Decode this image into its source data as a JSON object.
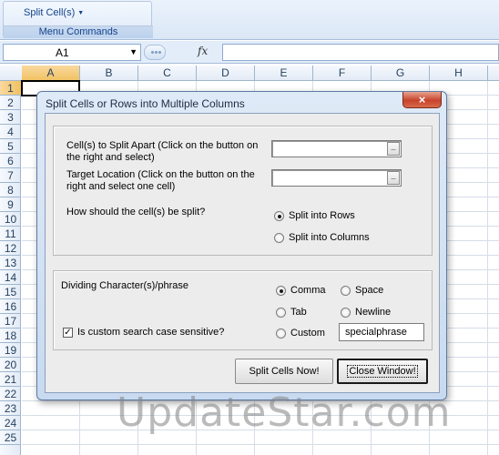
{
  "ribbon": {
    "split_menu_label": "Split Cell(s)",
    "group_label": "Menu Commands"
  },
  "formula_bar": {
    "name_box": "A1",
    "fx_label": "fx",
    "formula": ""
  },
  "grid": {
    "columns": [
      "A",
      "B",
      "C",
      "D",
      "E",
      "F",
      "G",
      "H"
    ],
    "rows": [
      "1",
      "2",
      "3",
      "4",
      "5",
      "6",
      "7",
      "8",
      "9",
      "10",
      "11",
      "12",
      "13",
      "14",
      "15",
      "16",
      "17",
      "18",
      "19",
      "20",
      "21",
      "22",
      "23",
      "24",
      "25"
    ],
    "active_column": "A",
    "active_row": "1"
  },
  "dialog": {
    "title": "Split Cells or Rows into Multiple Columns",
    "close_icon": "×",
    "split_apart_label": "Cell(s) to Split Apart (Click on the button on the right and select)",
    "split_apart_value": "",
    "target_label": "Target Location (Click on the button on the right and select one cell)",
    "target_value": "",
    "refedit_button_label": "_",
    "how_label": "How should the cell(s) be split?",
    "split_mode_options": [
      {
        "label": "Split into Rows",
        "checked": true
      },
      {
        "label": "Split into Columns",
        "checked": false
      }
    ],
    "dividing_label": "Dividing Character(s)/phrase",
    "dividers": [
      {
        "label": "Comma",
        "checked": true
      },
      {
        "label": "Space",
        "checked": false
      },
      {
        "label": "Tab",
        "checked": false
      },
      {
        "label": "Newline",
        "checked": false
      },
      {
        "label": "Custom",
        "checked": false
      }
    ],
    "custom_phrase": "specialphrase",
    "case_sensitive_label": "Is custom search case sensitive?",
    "case_sensitive_checked": true,
    "split_now_label": "Split Cells Now!",
    "close_window_label": "Close Window!"
  },
  "watermark": "UpdateStar.com",
  "colors": {
    "ribbon_text": "#15428b",
    "dialog_frame": "#c8daf0",
    "close_button": "#c7432b",
    "active_header": "#f1c15f"
  }
}
